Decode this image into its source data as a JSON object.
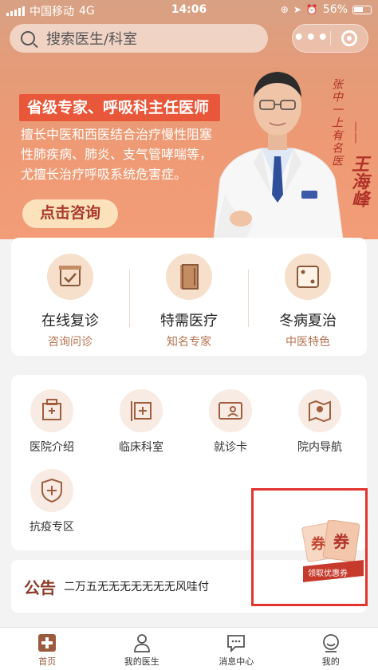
{
  "status_bar": {
    "carrier": "中国移动",
    "network": "4G",
    "time": "14:06",
    "battery": "56%"
  },
  "search": {
    "placeholder": "搜索医生/科室"
  },
  "banner": {
    "title": "省级专家、呼吸科主任医师",
    "description": "擅长中医和西医结合治疗慢性阻塞性肺疾病、肺炎、支气管哮喘等，尤擅长治疗呼吸系统危害症。",
    "cta": "点击咨询",
    "signature_motto": "张中一上有名医",
    "signature_name": "王海峰",
    "signature_dash": "——"
  },
  "services": [
    {
      "title": "在线复诊",
      "subtitle": "咨询问诊",
      "icon": "calendar-check-icon"
    },
    {
      "title": "特需医疗",
      "subtitle": "知名专家",
      "icon": "book-icon"
    },
    {
      "title": "冬病夏治",
      "subtitle": "中医特色",
      "icon": "dice-icon"
    }
  ],
  "quick_links": [
    {
      "label": "医院介绍",
      "icon": "hospital-building-icon"
    },
    {
      "label": "临床科室",
      "icon": "clinic-sign-icon"
    },
    {
      "label": "就诊卡",
      "icon": "patient-card-icon"
    },
    {
      "label": "院内导航",
      "icon": "map-pin-icon"
    },
    {
      "label": "抗疫专区",
      "icon": "shield-cross-icon"
    }
  ],
  "notice": {
    "tag": "公告",
    "text": "二万五无无无无无无无风哇付"
  },
  "coupon": {
    "char1": "券",
    "char2": "券",
    "ribbon": "领取优惠券"
  },
  "tabs": [
    {
      "label": "首页",
      "icon": "home-plus-icon",
      "active": true
    },
    {
      "label": "我的医生",
      "icon": "doctor-icon",
      "active": false
    },
    {
      "label": "消息中心",
      "icon": "message-icon",
      "active": false
    },
    {
      "label": "我的",
      "icon": "profile-icon",
      "active": false
    }
  ],
  "colors": {
    "accent": "#9b5b3e",
    "banner_title_bg": "#e9573a",
    "highlight": "#e3342f"
  }
}
